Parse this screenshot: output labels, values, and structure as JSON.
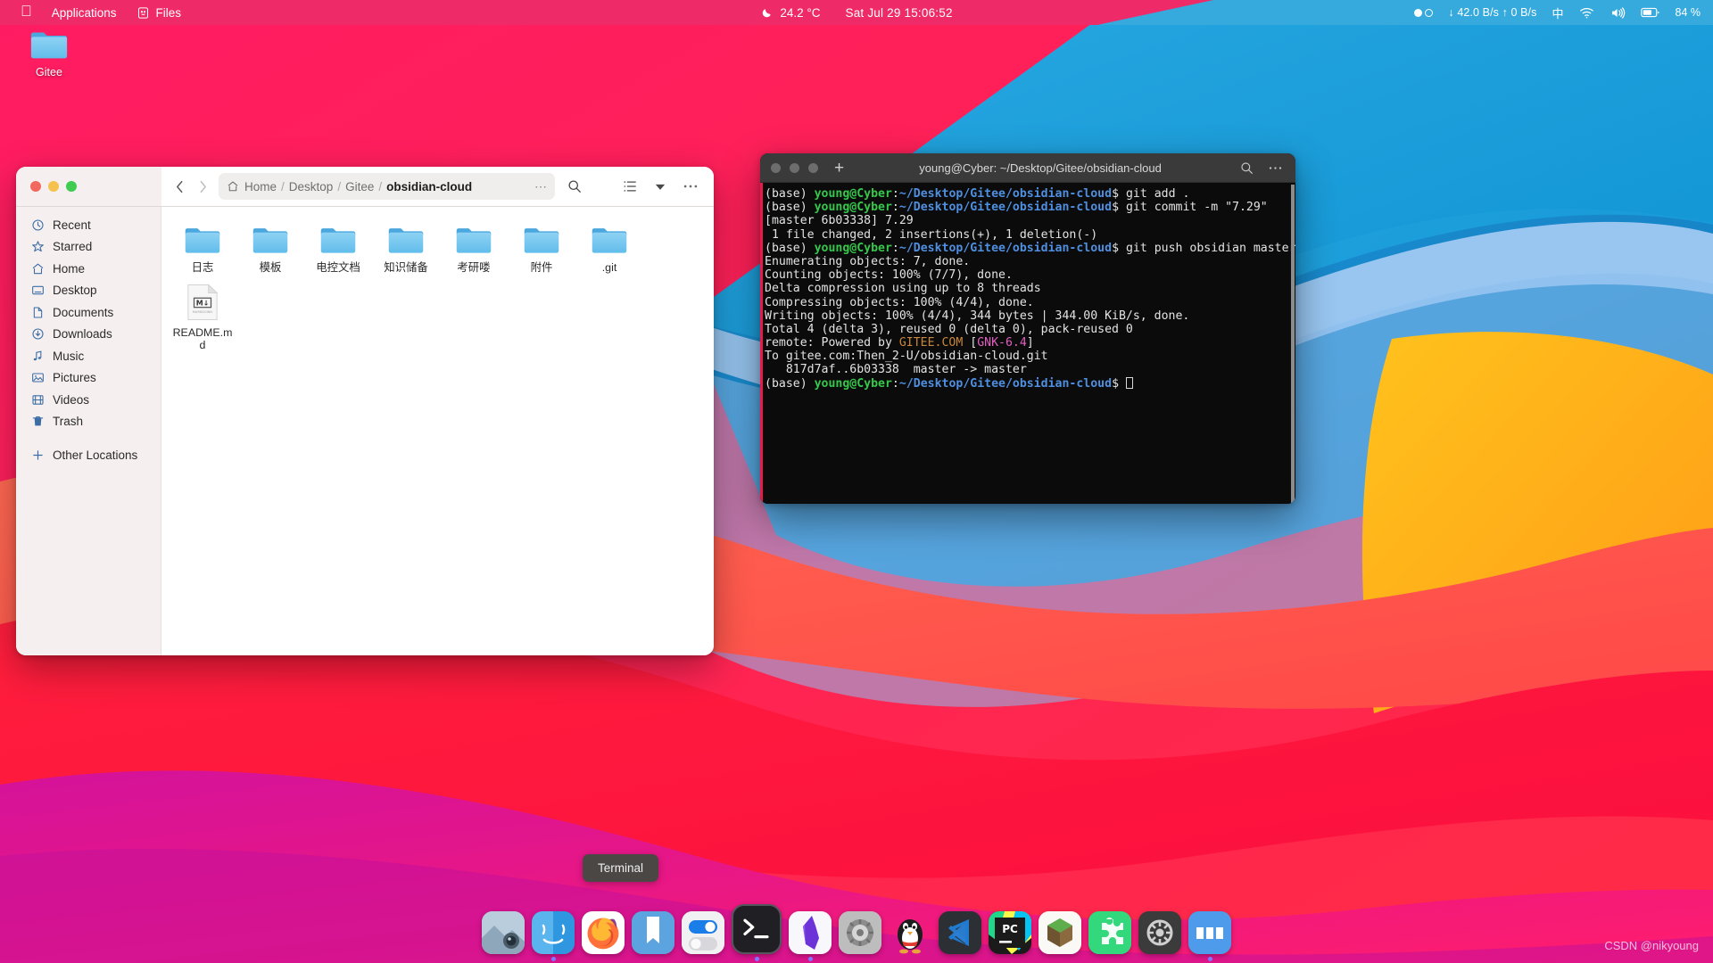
{
  "topbar": {
    "apple_icon": "apple-logo-icon",
    "applications_label": "Applications",
    "files_label": "Files",
    "files_icon": "files-icon",
    "weather_icon": "moon-icon",
    "temperature": "24.2 °C",
    "clock": "Sat Jul 29  15:06:52",
    "indicator_icon": "toggle-dots-icon",
    "network_speed": "↓ 42.0 B/s ↑ 0 B/s",
    "ime_label": "中",
    "wifi_icon": "wifi-icon",
    "volume_icon": "volume-icon",
    "battery_icon": "battery-icon",
    "battery_percent": "84 %"
  },
  "desktop": {
    "icon_name": "Gitee",
    "icon_type": "folder-icon"
  },
  "file_manager": {
    "window_controls": [
      "close",
      "minimize",
      "maximize"
    ],
    "back_icon": "chevron-left-icon",
    "forward_icon": "chevron-right-icon",
    "home_icon": "home-icon",
    "breadcrumbs": [
      "Home",
      "Desktop",
      "Gitee",
      "obsidian-cloud"
    ],
    "path_overflow": "⋯",
    "search_icon": "search-icon",
    "list_view_icon": "list-view-icon",
    "view_dropdown_icon": "chevron-down-icon",
    "menu_icon": "more-options-icon",
    "sidebar": [
      {
        "label": "Recent",
        "icon": "clock-icon"
      },
      {
        "label": "Starred",
        "icon": "star-icon"
      },
      {
        "label": "Home",
        "icon": "home-icon"
      },
      {
        "label": "Desktop",
        "icon": "desktop-icon"
      },
      {
        "label": "Documents",
        "icon": "document-icon"
      },
      {
        "label": "Downloads",
        "icon": "download-icon"
      },
      {
        "label": "Music",
        "icon": "music-icon"
      },
      {
        "label": "Pictures",
        "icon": "picture-icon"
      },
      {
        "label": "Videos",
        "icon": "video-icon"
      },
      {
        "label": "Trash",
        "icon": "trash-icon"
      },
      {
        "label": "Other Locations",
        "icon": "plus-icon"
      }
    ],
    "files": [
      {
        "name": "日志",
        "type": "folder"
      },
      {
        "name": "模板",
        "type": "folder"
      },
      {
        "name": "电控文档",
        "type": "folder"
      },
      {
        "name": "知识储备",
        "type": "folder"
      },
      {
        "name": "考研喽",
        "type": "folder"
      },
      {
        "name": "附件",
        "type": "folder"
      },
      {
        "name": ".git",
        "type": "folder"
      },
      {
        "name": "README.md",
        "type": "markdown",
        "badge": "M↓",
        "badge_sub": "MARKDOWN"
      }
    ]
  },
  "terminal": {
    "title": "young@Cyber: ~/Desktop/Gitee/obsidian-cloud",
    "new_tab_icon": "plus-icon",
    "search_icon": "search-icon",
    "menu_icon": "more-options-icon",
    "prompt_env": "(base) ",
    "prompt_user": "young@Cyber",
    "prompt_colon": ":",
    "prompt_path": "~/Desktop/Gitee/obsidian-cloud",
    "prompt_dollar": "$ ",
    "lines": [
      {
        "kind": "prompt",
        "command": "git add ."
      },
      {
        "kind": "prompt",
        "command": "git commit -m \"7.29\""
      },
      {
        "kind": "out",
        "text": "[master 6b03338] 7.29"
      },
      {
        "kind": "out",
        "text": " 1 file changed, 2 insertions(+), 1 deletion(-)"
      },
      {
        "kind": "prompt",
        "command": "git push obsidian master"
      },
      {
        "kind": "out",
        "text": "Enumerating objects: 7, done."
      },
      {
        "kind": "out",
        "text": "Counting objects: 100% (7/7), done."
      },
      {
        "kind": "out",
        "text": "Delta compression using up to 8 threads"
      },
      {
        "kind": "out",
        "text": "Compressing objects: 100% (4/4), done."
      },
      {
        "kind": "out",
        "text": "Writing objects: 100% (4/4), 344 bytes | 344.00 KiB/s, done."
      },
      {
        "kind": "out",
        "text": "Total 4 (delta 3), reused 0 (delta 0), pack-reused 0"
      },
      {
        "kind": "remote",
        "pre": "remote: Powered by ",
        "gold": "GITEE.COM",
        "mid": " [",
        "mag": "GNK-6.4",
        "post": "]"
      },
      {
        "kind": "out",
        "text": "To gitee.com:Then_2-U/obsidian-cloud.git"
      },
      {
        "kind": "out",
        "text": "   817d7af..6b03338  master -> master"
      },
      {
        "kind": "prompt",
        "command": "",
        "cursor": true
      }
    ]
  },
  "tooltip": {
    "label": "Terminal"
  },
  "dock": [
    {
      "name": "screenshot-tool",
      "icon": "camera-icon",
      "running": false
    },
    {
      "name": "files",
      "icon": "finder-icon",
      "running": true
    },
    {
      "name": "firefox",
      "icon": "firefox-icon",
      "running": false
    },
    {
      "name": "obsidian-vault",
      "icon": "bookmark-icon",
      "running": false
    },
    {
      "name": "settings-toggles",
      "icon": "toggles-icon",
      "running": false
    },
    {
      "name": "terminal",
      "icon": "terminal-icon",
      "running": true,
      "active": true
    },
    {
      "name": "obsidian",
      "icon": "obsidian-icon",
      "running": true
    },
    {
      "name": "system-preferences",
      "icon": "gear-disc-icon",
      "running": false
    },
    {
      "name": "qq",
      "icon": "penguin-icon",
      "running": false
    },
    {
      "name": "vs-code",
      "icon": "vscode-icon",
      "running": false
    },
    {
      "name": "pycharm",
      "icon": "pycharm-icon",
      "running": false
    },
    {
      "name": "package-manager",
      "icon": "box-icon",
      "running": false
    },
    {
      "name": "extensions",
      "icon": "puzzle-icon",
      "running": false
    },
    {
      "name": "tweaks",
      "icon": "gear-icon",
      "running": false
    },
    {
      "name": "show-desktop",
      "icon": "windows-icon",
      "running": true
    }
  ],
  "watermark": {
    "text": "CSDN @nikyoung"
  },
  "colors": {
    "wallpaper_pink": "#ff1f5a",
    "wallpaper_blue": "#1ea5dc",
    "wallpaper_orange": "#ffab1f",
    "topbar_pink": "#ef2a68",
    "topbar_blue": "#36a9dd",
    "terminal_bg": "#0b0b0b",
    "terminal_green": "#35c84a",
    "terminal_blue": "#4f8fe0",
    "gitee_gold": "#c9873a",
    "gnk_magenta": "#e060c0"
  }
}
